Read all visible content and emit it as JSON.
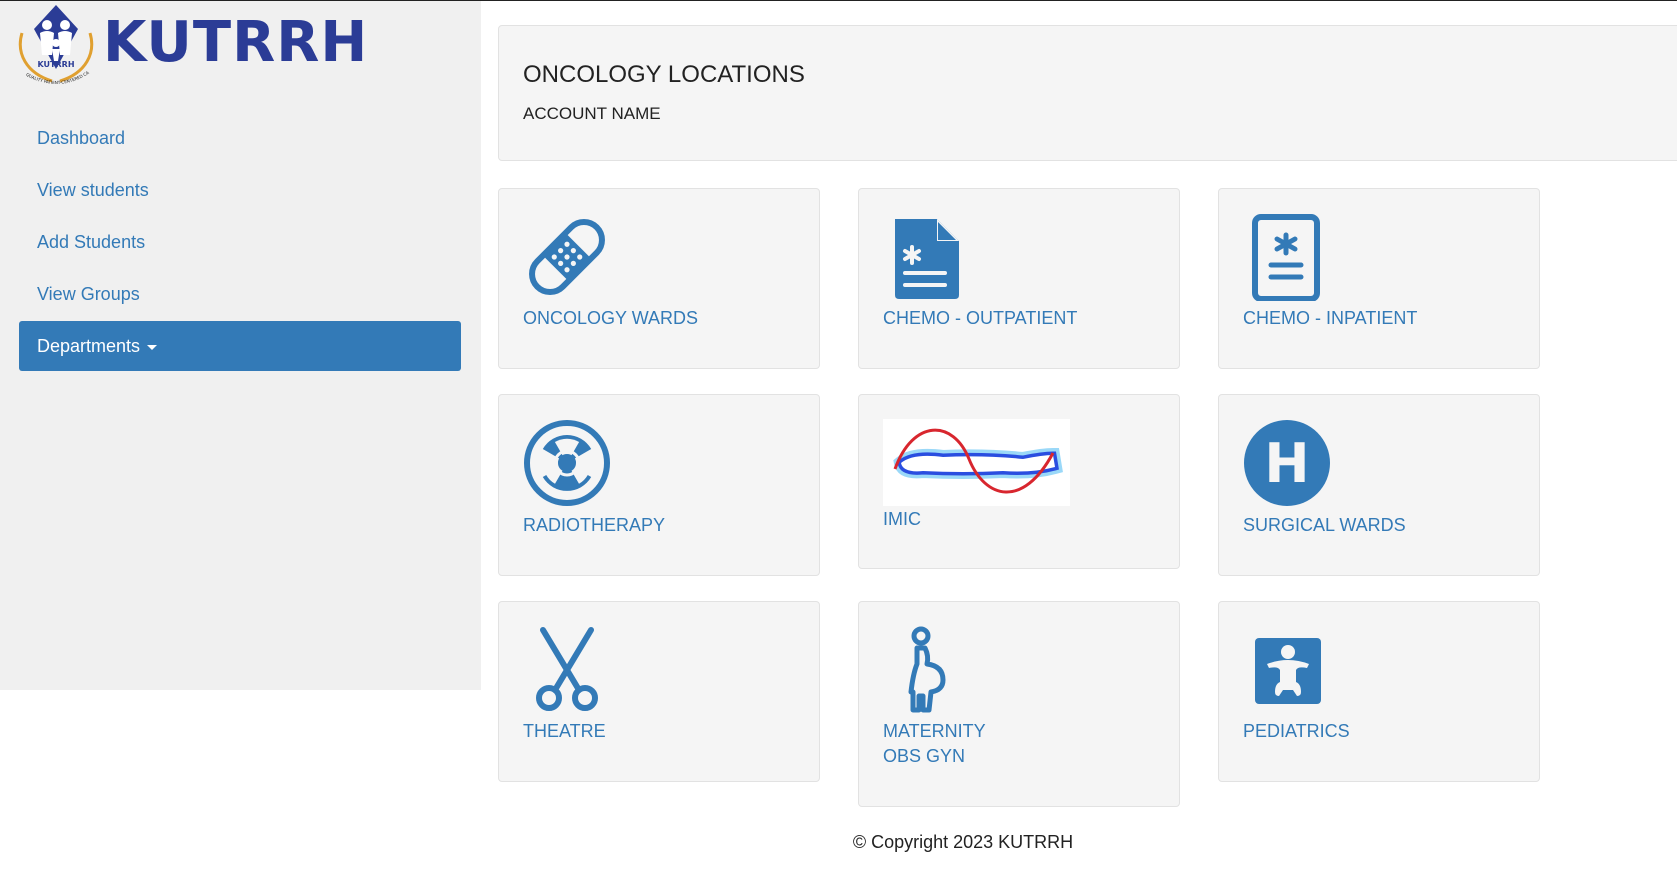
{
  "brand": {
    "name": "KUTRRH",
    "emblem_text": "KUTRRH",
    "emblem_motto": "QUALITY PATIENT-CENTERED CARE"
  },
  "sidebar": {
    "items": [
      {
        "label": "Dashboard"
      },
      {
        "label": "View students"
      },
      {
        "label": "Add Students"
      },
      {
        "label": "View Groups"
      },
      {
        "label": "Departments"
      }
    ]
  },
  "header": {
    "title": "ONCOLOGY LOCATIONS",
    "subtitle": "ACCOUNT NAME"
  },
  "tiles": [
    {
      "label": "ONCOLOGY WARDS",
      "icon": "bandage-icon"
    },
    {
      "label": "CHEMO - OUTPATIENT",
      "icon": "medical-file-icon"
    },
    {
      "label": "CHEMO - INPATIENT",
      "icon": "medical-clipboard-icon"
    },
    {
      "label": "RADIOTHERAPY",
      "icon": "radiation-icon"
    },
    {
      "label": "IMIC",
      "icon": "body-scan-image"
    },
    {
      "label": "SURGICAL WARDS",
      "icon": "hospital-h-icon"
    },
    {
      "label": "THEATRE",
      "icon": "scissors-icon"
    },
    {
      "label_line1": "MATERNITY",
      "label_line2": "OBS GYN",
      "icon": "pregnant-woman-icon"
    },
    {
      "label": "PEDIATRICS",
      "icon": "baby-icon"
    }
  ],
  "footer": {
    "copyright": "© Copyright 2023 KUTRRH"
  },
  "colors": {
    "primary": "#337ab7",
    "brand": "#2b3c96",
    "panel": "#f5f5f5",
    "sidebar": "#f0f0f0"
  }
}
